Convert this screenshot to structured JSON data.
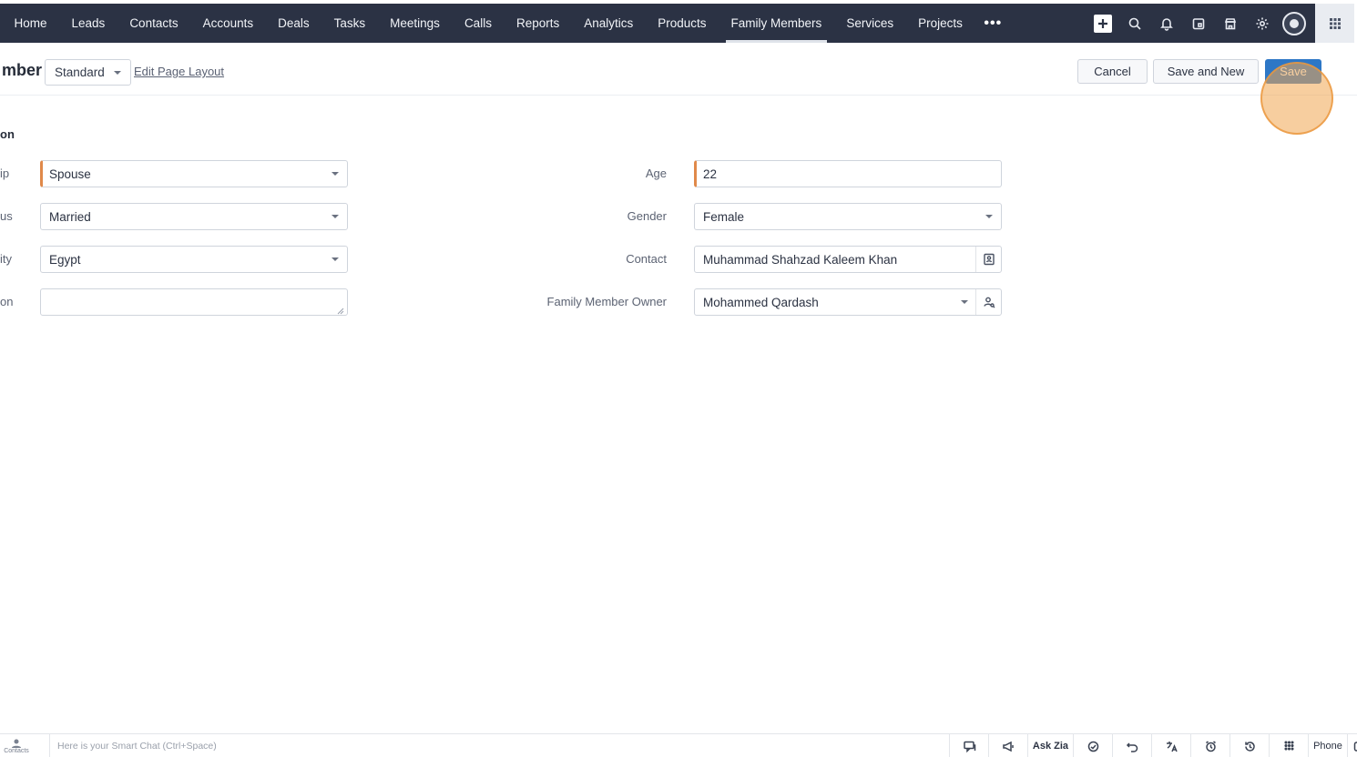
{
  "nav": {
    "tabs": [
      "Home",
      "Leads",
      "Contacts",
      "Accounts",
      "Deals",
      "Tasks",
      "Meetings",
      "Calls",
      "Reports",
      "Analytics",
      "Products",
      "Family Members",
      "Services",
      "Projects"
    ],
    "active_tab": "Family Members",
    "more_label": "•••",
    "icons": [
      "plus-icon",
      "search-icon",
      "bell-icon",
      "calendar-icon",
      "marketplace-icon",
      "gear-icon",
      "avatar",
      "apps-grid-icon"
    ]
  },
  "header": {
    "title": "mber",
    "layout_value": "Standard",
    "edit_layout_link": "Edit Page Layout",
    "cancel_label": "Cancel",
    "save_new_label": "Save and New",
    "save_label": "Save",
    "highlight_color": "#f0a550"
  },
  "section": {
    "title": "on"
  },
  "left_fields": [
    {
      "label": "ip",
      "value": "Spouse",
      "type": "dropdown",
      "required": true
    },
    {
      "label": "us",
      "value": "Married",
      "type": "dropdown",
      "required": false
    },
    {
      "label": "ity",
      "value": "Egypt",
      "type": "dropdown",
      "required": false
    },
    {
      "label": "on",
      "value": "",
      "type": "textarea",
      "required": false
    }
  ],
  "right_fields": [
    {
      "label": "Age",
      "value": "22",
      "type": "text",
      "required": true
    },
    {
      "label": "Gender",
      "value": "Female",
      "type": "dropdown",
      "required": false
    },
    {
      "label": "Contact",
      "value": "Muhammad Shahzad Kaleem Khan",
      "type": "lookup",
      "required": false
    },
    {
      "label": "Family Member Owner",
      "value": "Mohammed Qardash",
      "type": "user-lookup",
      "required": false
    }
  ],
  "bottombar": {
    "contacts_label": "Contacts",
    "chat_placeholder": "Here is your Smart Chat (Ctrl+Space)",
    "ask_zia": "Ask Zia",
    "phone": "Phone"
  },
  "colors": {
    "nav_bg": "#2b3244",
    "save_bg": "#2d77c6",
    "required_marker": "#e0894a"
  }
}
